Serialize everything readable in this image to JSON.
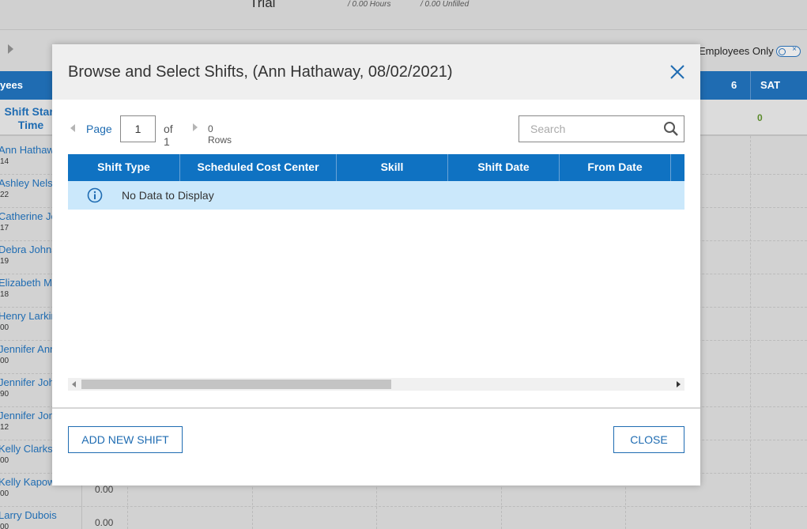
{
  "background": {
    "trial_label": "Trial",
    "hours_text": "/ 0.00 Hours",
    "unfilled_text": "/ 0.00 Unfilled",
    "employees_only_label": "Employees Only",
    "header_left": "yees",
    "header_day_6": "6",
    "header_sat": "SAT",
    "shift_start_line1": "Shift Start",
    "shift_start_line2": "Time",
    "sat_count": "0",
    "rows": [
      {
        "name": "Ann Hathaw",
        "num": "14",
        "val": ""
      },
      {
        "name": "Ashley Nels",
        "num": "22",
        "val": ""
      },
      {
        "name": "Catherine Je",
        "num": "17",
        "val": ""
      },
      {
        "name": "Debra Johns",
        "num": "19",
        "val": ""
      },
      {
        "name": "Elizabeth M",
        "num": "18",
        "val": ""
      },
      {
        "name": "Henry Larkin",
        "num": "00",
        "val": ""
      },
      {
        "name": "Jennifer Ann",
        "num": "00",
        "val": ""
      },
      {
        "name": "Jennifer Joh",
        "num": "90",
        "val": ""
      },
      {
        "name": "Jennifer Jon",
        "num": "12",
        "val": ""
      },
      {
        "name": "Kelly Clarks",
        "num": "00",
        "val": ""
      },
      {
        "name": "Kelly Kapowski",
        "num": "00",
        "val": "0.00"
      },
      {
        "name": "Larry Dubois",
        "num": "00",
        "val": "0.00"
      }
    ]
  },
  "modal": {
    "title": "Browse and Select Shifts, (Ann Hathaway, 08/02/2021)",
    "pager": {
      "page_label": "Page",
      "page_value": "1",
      "of_text": "of 1",
      "rows_text": "0 Rows"
    },
    "search": {
      "placeholder": "Search"
    },
    "columns": [
      "Shift Type",
      "Scheduled Cost Center",
      "Skill",
      "Shift Date",
      "From Date"
    ],
    "empty_message": "No Data to Display",
    "buttons": {
      "add_new_shift": "ADD NEW SHIFT",
      "close": "CLOSE"
    }
  },
  "colors": {
    "accent": "#1f6cb2",
    "grid_header": "#0f72c2",
    "empty_row": "#cbe8fb"
  }
}
